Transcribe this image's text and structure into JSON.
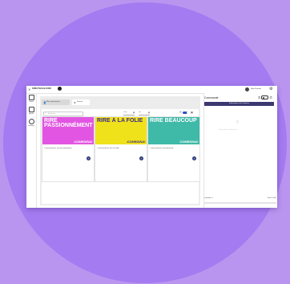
{
  "header": {
    "close_icon": "close-icon",
    "logo": "SPECTACLE.COM",
    "logo_sub": "",
    "user_name": "Nom Prénom",
    "settings_icon": "gear-icon"
  },
  "sidebar": {
    "items": [
      {
        "icon": "ticket-icon",
        "label": "Guichet"
      },
      {
        "icon": "calendar-icon",
        "label": "Agenda"
      },
      {
        "icon": "history-icon",
        "label": "Historique"
      }
    ]
  },
  "tabs": [
    {
      "icon": "person-icon",
      "label": "Mes événements"
    },
    {
      "icon": "star-icon",
      "label": "Favoris"
    }
  ],
  "filters": {
    "search_placeholder": "Rechercher",
    "date_from_label": "Date",
    "date_to_label": "Au"
  },
  "cards": [
    {
      "title": "RIRE PASSIONNÉMENT",
      "brand": "COMEDINA!",
      "color": "#e255e2",
      "text": "Laissez-passer rire passionnément"
    },
    {
      "title": "RIRE À LA FOLIE",
      "brand": "COMEDINA!",
      "color": "#f0e21a",
      "text": "Laissez-passer rire à la folie"
    },
    {
      "title": "RIRE BEAUCOUP",
      "brand": "COMEDINA!",
      "color": "#3fb9a8",
      "text": "Laissez-passer rire beaucoup"
    }
  ],
  "order": {
    "title": "Commande",
    "info_button": "Informations de l'acheteur",
    "empty_text": "Aucun produit sélectionné",
    "quantity": "Quantité: 0",
    "total": "Total: 0,00€"
  },
  "colors": {
    "accent": "#3b3770",
    "toggle": "#2f4fbf",
    "background": "#a47bf0"
  }
}
